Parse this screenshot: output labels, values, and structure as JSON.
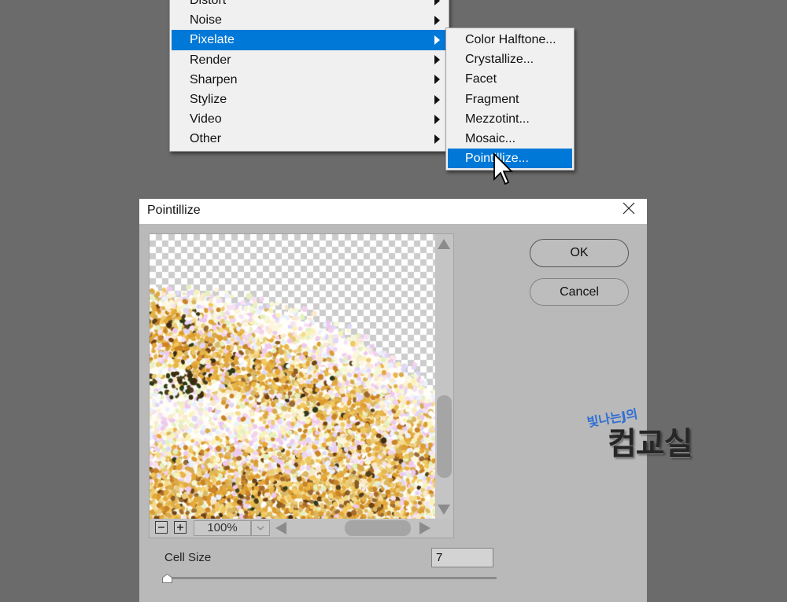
{
  "colors": {
    "workspace_bg": "#6b6b6b",
    "menu_bg": "#f0f0f0",
    "menu_highlight": "#0078d7",
    "dialog_bg": "#b9b9b9",
    "watermark_blue": "#2f6fd6"
  },
  "icons": {
    "submenu_arrow": "triangle-right-icon",
    "cursor": "mouse-pointer-icon",
    "close": "close-icon",
    "zoom_out": "minus-icon",
    "zoom_in": "plus-icon",
    "zoom_dropdown": "chevron-down-icon",
    "scroll_up": "triangle-up-icon",
    "scroll_down": "triangle-down-icon",
    "scroll_left": "triangle-left-icon",
    "scroll_right": "triangle-right-icon",
    "slider_thumb": "slider-thumb-icon"
  },
  "menu": {
    "items": [
      {
        "label": "Distort"
      },
      {
        "label": "Noise"
      },
      {
        "label": "Pixelate",
        "highlighted": true
      },
      {
        "label": "Render"
      },
      {
        "label": "Sharpen"
      },
      {
        "label": "Stylize"
      },
      {
        "label": "Video"
      },
      {
        "label": "Other"
      }
    ]
  },
  "submenu": {
    "items": [
      {
        "label": "Color Halftone..."
      },
      {
        "label": "Crystallize..."
      },
      {
        "label": "Facet"
      },
      {
        "label": "Fragment"
      },
      {
        "label": "Mezzotint..."
      },
      {
        "label": "Mosaic..."
      },
      {
        "label": "Pointillize...",
        "highlighted": true
      }
    ]
  },
  "dialog": {
    "title": "Pointillize",
    "buttons": {
      "ok": "OK",
      "cancel": "Cancel"
    },
    "preview": {
      "zoom_level": "100%"
    },
    "cell_size": {
      "label": "Cell Size",
      "value": "7",
      "slider_level": 0.0135
    }
  },
  "watermark": {
    "line1": "빛나는J의",
    "line2": "컴교실"
  }
}
